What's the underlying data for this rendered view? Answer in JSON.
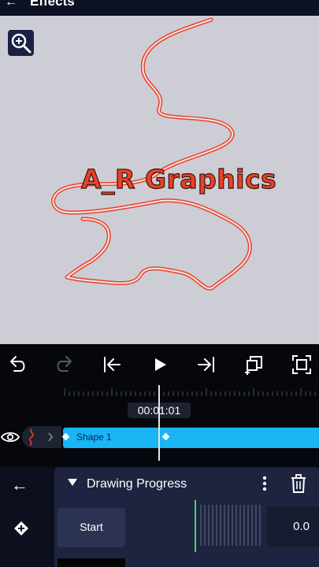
{
  "header": {
    "title": "Effects",
    "back_icon": "back-arrow-icon"
  },
  "canvas": {
    "background": "#cdcdd6",
    "watermark": "A_R Graphics",
    "zoom_icon": "zoom-in-icon",
    "path_color": "#e8422a"
  },
  "toolbar": {
    "buttons": [
      "undo-icon",
      "redo-icon",
      "skip-to-start-icon",
      "play-icon",
      "skip-to-end-icon",
      "duplicate-layer-icon",
      "fit-screen-icon"
    ]
  },
  "timeline": {
    "timecode": "00:01:01",
    "clip_label": "Shape 1",
    "clip_color": "#19b5f5"
  },
  "panel": {
    "title": "Drawing Progress",
    "row_label": "Start",
    "value": "0.0",
    "accent": "#3ddc6a"
  }
}
